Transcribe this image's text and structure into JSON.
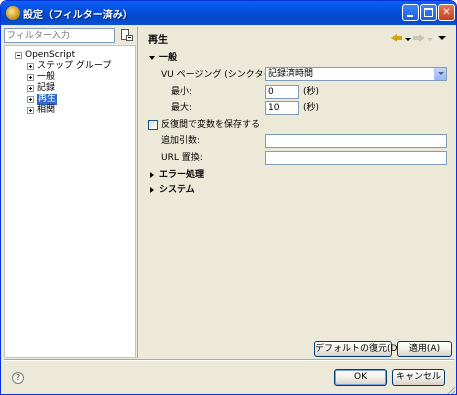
{
  "window": {
    "title": "設定（フィルター済み）",
    "close_glyph": "✕"
  },
  "left": {
    "filter_placeholder": "フィルター入力",
    "tree": [
      {
        "label": "OpenScript",
        "expander": "minus"
      },
      {
        "label": "ステップ グループ",
        "expander": "plus"
      },
      {
        "label": "一般",
        "expander": "plus"
      },
      {
        "label": "記録",
        "expander": "plus"
      },
      {
        "label": "再生",
        "expander": "plus",
        "selected": true
      },
      {
        "label": "相関",
        "expander": "plus"
      }
    ]
  },
  "header": {
    "title": "再生"
  },
  "content": {
    "section_general": "一般",
    "vu_pacing_label": "VU ページング (シンクタイム):",
    "vu_pacing_value": "記録済時間",
    "min_label": "最小:",
    "min_value": "0",
    "min_unit": "(秒)",
    "max_label": "最大:",
    "max_value": "10",
    "max_unit": "(秒)",
    "preserve_vars_label": "反復間で変数を保存する",
    "extra_args_label": "追加引数:",
    "extra_args_value": "",
    "url_replace_label": "URL 置換:",
    "url_replace_value": "",
    "section_error": "エラー処理",
    "section_system": "システム"
  },
  "buttons": {
    "restore_defaults": "デフォルトの復元(D)",
    "apply": "適用(A)",
    "ok": "OK",
    "cancel": "キャンセル"
  },
  "footer": {
    "help_glyph": "?"
  },
  "colors": {
    "titlebar": "#0553e5",
    "selection": "#316ac5",
    "dialog_bg": "#ece9d8"
  }
}
